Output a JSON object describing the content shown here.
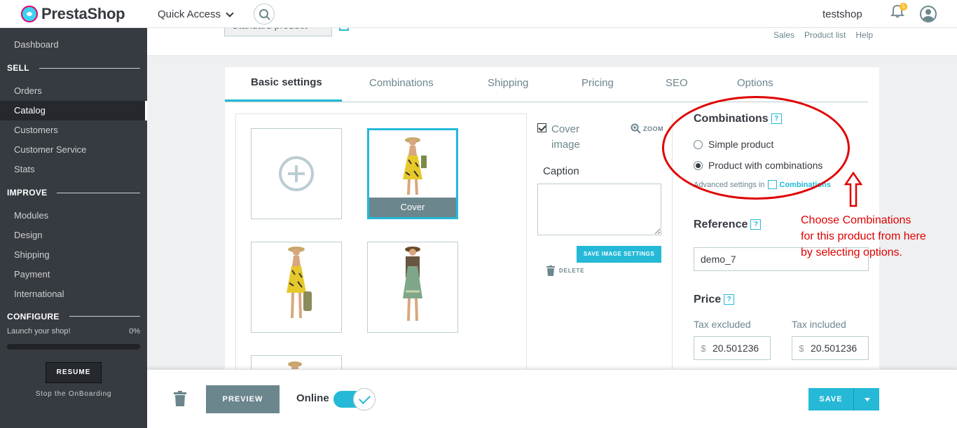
{
  "header": {
    "logo_text": "PrestaShop",
    "quick_access": "Quick Access",
    "shop_name": "testshop",
    "notification_count": "5"
  },
  "sidebar": {
    "dashboard": "Dashboard",
    "sections": {
      "sell": "SELL",
      "improve": "IMPROVE",
      "configure": "CONFIGURE"
    },
    "sell_items": [
      "Orders",
      "Catalog",
      "Customers",
      "Customer Service",
      "Stats"
    ],
    "improve_items": [
      "Modules",
      "Design",
      "Shipping",
      "Payment",
      "International"
    ],
    "active_item": "Catalog",
    "launch_label": "Launch your shop!",
    "launch_percent": "0%",
    "launch_progress": 0,
    "resume_label": "RESUME",
    "stop_onboarding": "Stop the OnBoarding"
  },
  "toolbar": {
    "product_type": "Standard product",
    "links": [
      "Sales",
      "Product list",
      "Help"
    ]
  },
  "tabs": [
    "Basic settings",
    "Combinations",
    "Shipping",
    "Pricing",
    "SEO",
    "Options"
  ],
  "active_tab": "Basic settings",
  "images": {
    "cover_label": "Cover",
    "cover_image_label": "Cover image",
    "cover_checked": true,
    "zoom_label": "ZOOM",
    "caption_label": "Caption",
    "caption_value": "",
    "save_image_settings": "SAVE IMAGE SETTINGS",
    "delete_label": "DELETE"
  },
  "combinations": {
    "title": "Combinations",
    "help": "?",
    "options": [
      "Simple product",
      "Product with combinations"
    ],
    "selected": "Product with combinations",
    "advanced_text": "Advanced settings in",
    "advanced_link": "Combinations"
  },
  "reference": {
    "title": "Reference",
    "value": "demo_7"
  },
  "price": {
    "title": "Price",
    "tax_excluded_label": "Tax excluded",
    "tax_included_label": "Tax included",
    "currency": "$",
    "tax_excluded_value": "20.501236",
    "tax_included_value": "20.501236"
  },
  "annotation": "Choose Combinations for this product from here by selecting options.",
  "annotation_color": "#e00000",
  "accent_color": "#25b9d7",
  "footer": {
    "preview": "PREVIEW",
    "online": "Online",
    "online_enabled": true,
    "save": "SAVE"
  }
}
